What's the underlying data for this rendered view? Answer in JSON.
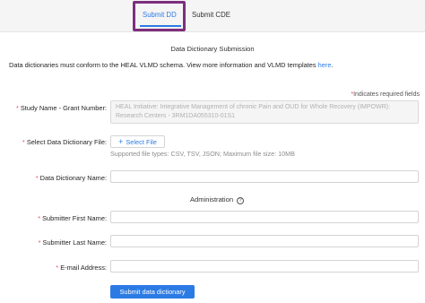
{
  "tabs": {
    "submit_dd": "Submit DD",
    "submit_cde": "Submit CDE"
  },
  "form": {
    "title": "Data Dictionary Submission",
    "intro_text": "Data dictionaries must conform to the HEAL VLMD schema. View more information and VLMD templates ",
    "intro_link": "here",
    "intro_end": ".",
    "required_note": "Indicates required fields",
    "study_name_label": "Study Name - Grant Number:",
    "study_name_value": "HEAL Initiative: Integrative Management of chronic Pain and OUD for Whole Recovery (IMPOWR): Research Centers - 3RM1DA055310-01S1",
    "select_file_label": "Select Data Dictionary File:",
    "select_file_button": "Select File",
    "file_hint": "Supported file types: CSV, TSV, JSON; Maximum file size: 10MB",
    "dd_name_label": "Data Dictionary Name:",
    "admin_title": "Administration",
    "first_name_label": "Submitter First Name:",
    "last_name_label": "Submitter Last Name:",
    "email_label": "E-mail Address:",
    "submit_button": "Submit data dictionary"
  },
  "icons": {
    "info": "info-circle-icon",
    "upload": "plus-icon"
  },
  "colors": {
    "accent": "#2c7be5",
    "required": "#e8505b",
    "highlight": "#7d2f7d"
  }
}
